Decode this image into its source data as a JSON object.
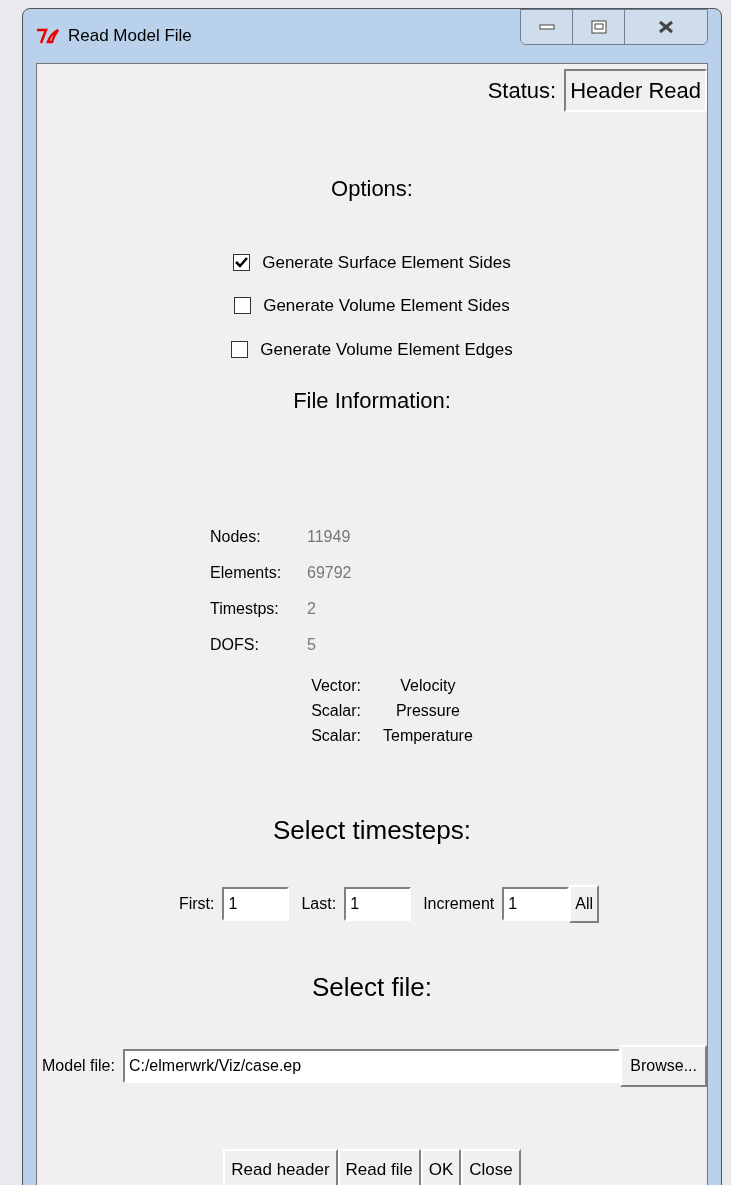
{
  "window": {
    "title": "Read Model File"
  },
  "status": {
    "label": "Status:",
    "value": "Header Read"
  },
  "options": {
    "heading": "Options:",
    "items": [
      {
        "label": "Generate Surface Element Sides",
        "checked": true
      },
      {
        "label": "Generate Volume Element Sides",
        "checked": false
      },
      {
        "label": "Generate Volume Element Edges",
        "checked": false
      }
    ]
  },
  "file_information": {
    "heading": "File Information:",
    "fields": [
      {
        "label": "Nodes:",
        "value": "11949"
      },
      {
        "label": "Elements:",
        "value": "69792"
      },
      {
        "label": "Timestps:",
        "value": "2"
      },
      {
        "label": "DOFS:",
        "value": "5"
      }
    ],
    "variables": [
      {
        "type": "Vector:",
        "name": "Velocity"
      },
      {
        "type": "Scalar:",
        "name": "Pressure"
      },
      {
        "type": "Scalar:",
        "name": "Temperature"
      }
    ]
  },
  "timesteps": {
    "heading": "Select timesteps:",
    "fields": [
      {
        "label": "First:",
        "value": "1"
      },
      {
        "label": "Last:",
        "value": "1"
      },
      {
        "label": "Increment",
        "value": "1"
      }
    ],
    "all_button": "All"
  },
  "select_file": {
    "heading": "Select file:",
    "label": "Model file:",
    "value": "C:/elmerwrk/Viz/case.ep",
    "browse_button": "Browse..."
  },
  "buttons": [
    "Read header",
    "Read file",
    "OK",
    "Close"
  ]
}
